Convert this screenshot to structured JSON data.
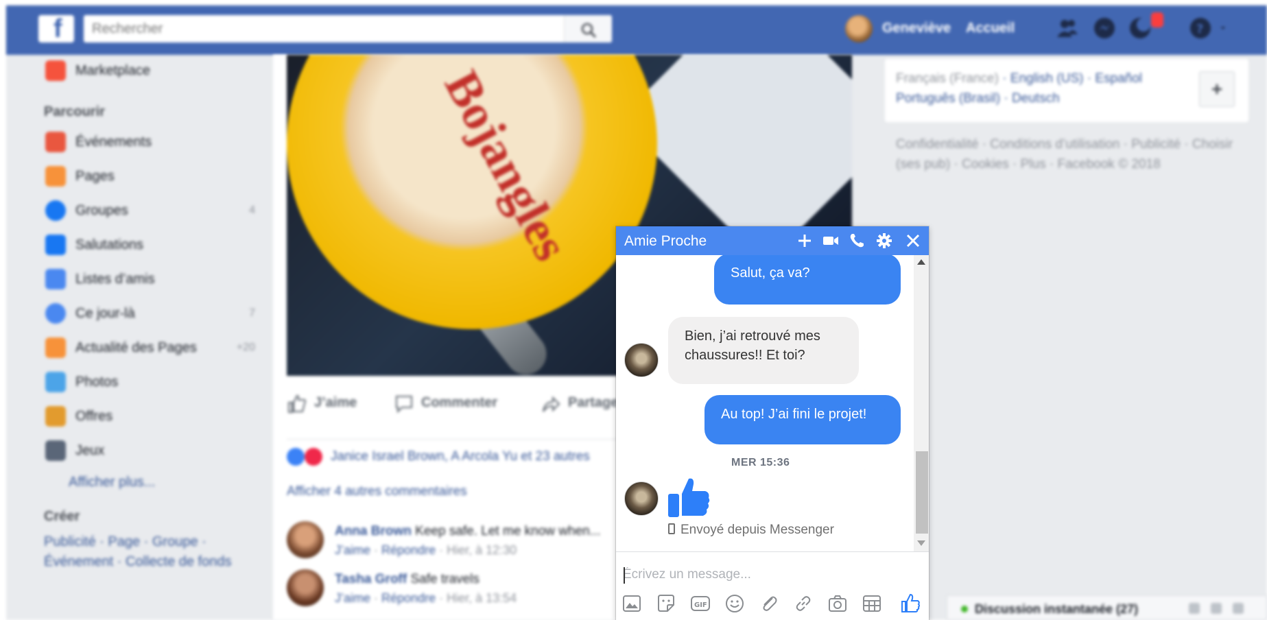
{
  "topbar": {
    "logo": "f",
    "search_placeholder": "Rechercher",
    "profile_name": "Geneviève",
    "home_label": "Accueil"
  },
  "sidebar": {
    "items": [
      {
        "label": "Marketplace",
        "count": "",
        "color": "#f5533d"
      },
      {
        "label": "Événements",
        "count": "",
        "color": "#e9573f"
      },
      {
        "label": "Pages",
        "count": "",
        "color": "#f7923a"
      },
      {
        "label": "Groupes",
        "count": "4",
        "color": "#1877f2"
      },
      {
        "label": "Salutations",
        "count": "",
        "color": "#1877f2"
      },
      {
        "label": "Listes d’amis",
        "count": "",
        "color": "#4a88f0"
      },
      {
        "label": "Ce jour-là",
        "count": "7",
        "color": "#4a88f0"
      },
      {
        "label": "Actualité des Pages",
        "count": "+20",
        "color": "#f7923a"
      },
      {
        "label": "Photos",
        "count": "",
        "color": "#4ca4e8"
      },
      {
        "label": "Offres",
        "count": "",
        "color": "#e29b2e"
      },
      {
        "label": "Jeux",
        "count": "",
        "color": "#5a6678"
      }
    ],
    "section_explore": "Parcourir",
    "see_more": "Afficher plus...",
    "section_create": "Créer",
    "create_links": "Publicité · Page · Groupe · Événement · Collecte de fonds"
  },
  "feed": {
    "cup_text": "Bojangles",
    "actions": {
      "like": "J’aime",
      "comment": "Commenter",
      "share": "Partager"
    },
    "reactions_text": "Janice Israel Brown, A Arcola Yu et 23 autres",
    "more_comments": "Afficher 4 autres commentaires",
    "comments": [
      {
        "author": "Anna Brown",
        "text": "Keep safe. Let me know when...",
        "like": "J’aime",
        "reply": "Répondre",
        "time": "Hier, à 12:30"
      },
      {
        "author": "Tasha Groff",
        "text": "Safe travels",
        "like": "J’aime",
        "reply": "Répondre",
        "time": "Hier, à 13:54"
      }
    ]
  },
  "right_col": {
    "lang_current": "Français (France)",
    "languages": [
      "English (US)",
      "Español",
      "Português (Brasil)",
      "Deutsch"
    ],
    "lang_add": "+",
    "footer_links": "Confidentialité · Conditions d’utilisation · Publicité · Choisir (ses pub) · Cookies · Plus · Facebook © 2018"
  },
  "bottom_bar": {
    "label": "Discussion instantanée (27)"
  },
  "chat": {
    "title": "Amie Proche",
    "messages": [
      {
        "from": "me",
        "text": "Salut, ça va?"
      },
      {
        "from": "friend",
        "text": "Bien, j’ai retrouvé mes chaussures!! Et toi?"
      },
      {
        "from": "me",
        "text": "Au top! J’ai fini  le projet!"
      }
    ],
    "timestamp": "MER 15:36",
    "sent_via": "Envoyé depuis Messenger",
    "composer_placeholder": "Écrivez un message..."
  },
  "colors": {
    "fb_blue": "#4267b2",
    "chat_header": "#4a88f0",
    "bubble_out": "#3a84f2",
    "bubble_in": "#f1f0f0"
  }
}
